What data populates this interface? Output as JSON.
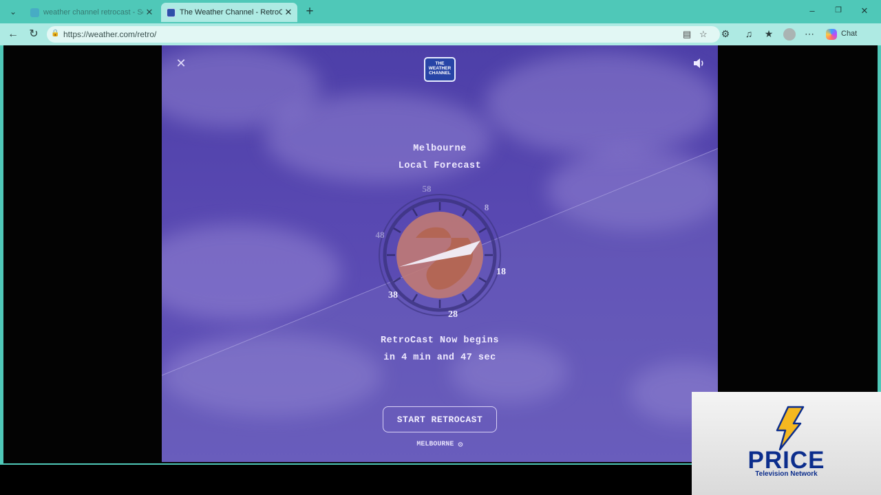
{
  "browser": {
    "tabs": [
      {
        "title": "weather channel retrocast - Search",
        "active": false
      },
      {
        "title": "The Weather Channel - RetroCast",
        "active": true
      }
    ],
    "url": "https://weather.com/retro/",
    "chat_label": "Chat"
  },
  "retrocast": {
    "logo_lines": [
      "THE",
      "WEATHER",
      "CHANNEL"
    ],
    "city": "Melbourne",
    "subtitle": "Local Forecast",
    "clock_numbers": [
      "58",
      "8",
      "18",
      "28",
      "38",
      "48"
    ],
    "countdown_line1": "RetroCast Now begins",
    "countdown_line2": "in 4 min and 47 sec",
    "start_button": "START RETROCAST",
    "location_label": "MELBOURNE"
  },
  "overlay": {
    "brand": "PRICE",
    "tagline": "Television Network",
    "bolt_color": "#f5b820",
    "brand_color": "#0b2d8c"
  }
}
